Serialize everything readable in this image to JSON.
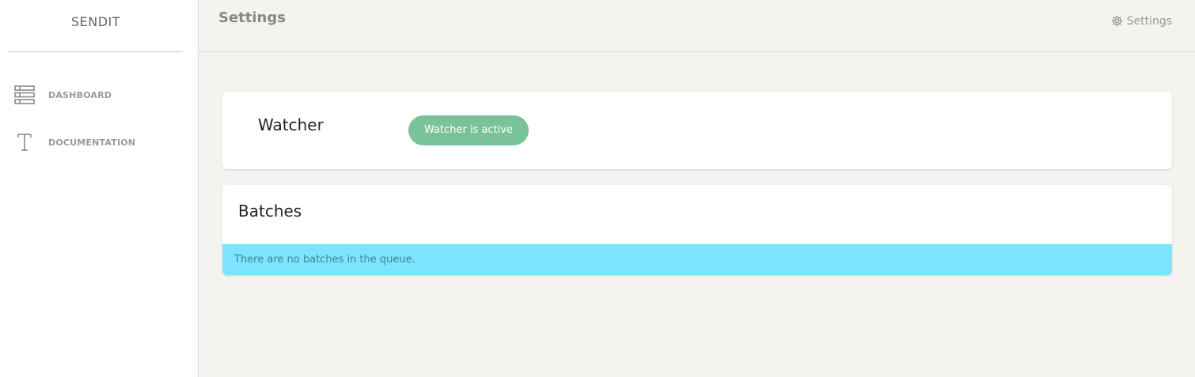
{
  "brand": {
    "name": "SENDIT"
  },
  "sidebar": {
    "items": [
      {
        "label": "DASHBOARD",
        "icon": "list-icon"
      },
      {
        "label": "DOCUMENTATION",
        "icon": "text-icon"
      }
    ]
  },
  "header": {
    "title": "Settings",
    "settings_label": "Settings",
    "settings_icon": "gear-icon"
  },
  "watcher": {
    "title": "Watcher",
    "status": "Watcher is active",
    "status_color": "#7ac29a"
  },
  "batches": {
    "title": "Batches",
    "empty_message": "There are no batches in the queue.",
    "alert_bg": "#7ce4fe",
    "alert_text_color": "#3d8597"
  }
}
